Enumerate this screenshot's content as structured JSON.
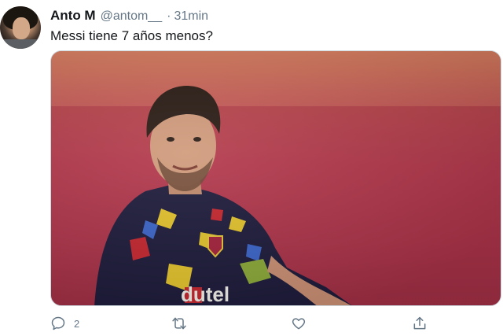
{
  "tweet": {
    "author_name": "Anto M",
    "handle": "@antom__",
    "separator": "·",
    "time": "31min",
    "text": "Messi tiene 7 años menos?",
    "media": {
      "jersey_text": "dutel"
    },
    "actions": {
      "reply_count": "2"
    }
  },
  "colors": {
    "text": "#14171a",
    "secondary": "#657786",
    "border": "#ccd6dd"
  },
  "icons": [
    "reply-icon",
    "retweet-icon",
    "like-icon",
    "share-icon"
  ]
}
